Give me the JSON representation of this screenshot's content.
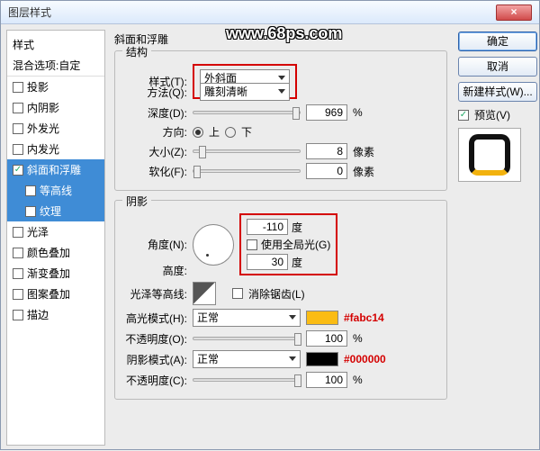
{
  "window": {
    "title": "图层样式"
  },
  "watermark": "www.68ps.com",
  "sidebar": {
    "head": "样式",
    "mix": "混合选项:自定",
    "items": [
      {
        "label": "投影",
        "checked": false
      },
      {
        "label": "内阴影",
        "checked": false
      },
      {
        "label": "外发光",
        "checked": false
      },
      {
        "label": "内发光",
        "checked": false
      },
      {
        "label": "斜面和浮雕",
        "checked": true,
        "selected": true
      },
      {
        "label": "等高线",
        "checked": false,
        "sub": true
      },
      {
        "label": "纹理",
        "checked": false,
        "sub": true
      },
      {
        "label": "光泽",
        "checked": false
      },
      {
        "label": "颜色叠加",
        "checked": false
      },
      {
        "label": "渐变叠加",
        "checked": false
      },
      {
        "label": "图案叠加",
        "checked": false
      },
      {
        "label": "描边",
        "checked": false
      }
    ]
  },
  "bevel": {
    "group": "斜面和浮雕",
    "structure_legend": "结构",
    "style_lbl": "样式(T):",
    "style_val": "外斜面",
    "technique_lbl": "方法(Q):",
    "technique_val": "雕刻清晰",
    "depth_lbl": "深度(D):",
    "depth_val": "969",
    "pct": "%",
    "direction_lbl": "方向:",
    "up": "上",
    "down": "下",
    "size_lbl": "大小(Z):",
    "size_val": "8",
    "px": "像素",
    "soften_lbl": "软化(F):",
    "soften_val": "0"
  },
  "shading": {
    "legend": "阴影",
    "angle_lbl": "角度(N):",
    "angle_val": "-110",
    "deg": "度",
    "global_lbl": "使用全局光(G)",
    "alt_lbl": "高度:",
    "alt_val": "30",
    "gloss_lbl": "光泽等高线:",
    "anti_lbl": "消除锯齿(L)",
    "hi_mode_lbl": "高光模式(H):",
    "hi_mode_val": "正常",
    "hi_hex": "#fabc14",
    "hi_op_lbl": "不透明度(O):",
    "hi_op_val": "100",
    "sh_mode_lbl": "阴影模式(A):",
    "sh_mode_val": "正常",
    "sh_hex": "#000000",
    "sh_op_lbl": "不透明度(C):",
    "sh_op_val": "100"
  },
  "buttons": {
    "ok": "确定",
    "cancel": "取消",
    "newstyle": "新建样式(W)...",
    "preview": "预览(V)"
  },
  "colors": {
    "highlight": "#fabc14",
    "shadow": "#000000"
  }
}
